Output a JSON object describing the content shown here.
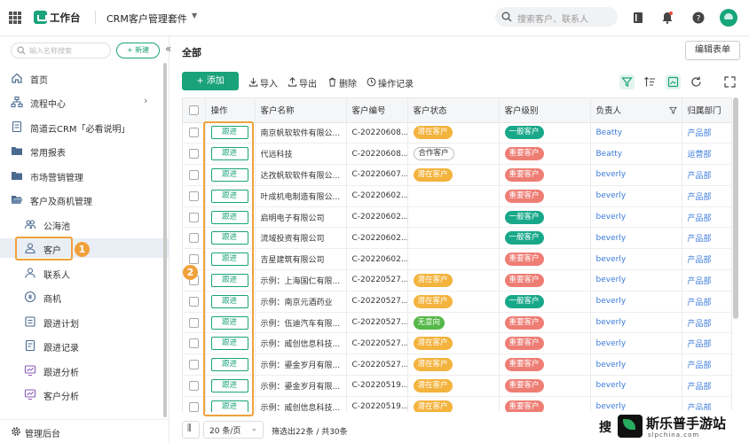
{
  "topbar": {
    "workbench": "工作台",
    "app_title": "CRM客户管理套件",
    "search_placeholder": "搜索客户、联系人"
  },
  "sidebar": {
    "search_placeholder": "输入名称搜索",
    "new_label": "+ 新建",
    "items": [
      {
        "label": "首页",
        "icon": "home-icon"
      },
      {
        "label": "流程中心",
        "icon": "flow-icon"
      },
      {
        "label": "简道云CRM「必看说明」",
        "icon": "doc-icon"
      },
      {
        "label": "常用报表",
        "icon": "folder-icon"
      },
      {
        "label": "市场营销管理",
        "icon": "folder-icon"
      },
      {
        "label": "客户及商机管理",
        "icon": "folder-open-icon"
      },
      {
        "label": "公海池",
        "icon": "pool-icon"
      },
      {
        "label": "客户",
        "icon": "user-icon"
      },
      {
        "label": "联系人",
        "icon": "contact-icon"
      },
      {
        "label": "商机",
        "icon": "opportunity-icon"
      },
      {
        "label": "跟进计划",
        "icon": "plan-icon"
      },
      {
        "label": "跟进记录",
        "icon": "record-icon"
      },
      {
        "label": "跟进分析",
        "icon": "analysis-icon"
      },
      {
        "label": "客户分析",
        "icon": "analysis-icon"
      }
    ],
    "footer": "管理后台",
    "marker1": "1"
  },
  "main": {
    "title": "全部",
    "edit_form": "编辑表单",
    "add": "添加",
    "tools": [
      "导入",
      "导出",
      "删除",
      "操作记录"
    ],
    "marker2": "2"
  },
  "table": {
    "headers": [
      "操作",
      "客户名称",
      "客户编号",
      "客户状态",
      "客户级别",
      "负责人",
      "归属部门"
    ],
    "follow_label": "跟进",
    "rows": [
      {
        "name": "南京帆软软件有限公...",
        "code": "C-20220608...",
        "status": "潜在客户",
        "level": "一般客户",
        "owner": "Beatty",
        "dept": "产品部"
      },
      {
        "name": "代远科技",
        "code": "C-20220608...",
        "status": "合作客户",
        "level": "重要客户",
        "owner": "Beatty",
        "dept": "运营部"
      },
      {
        "name": "达孜帆软软件有限公...",
        "code": "C-20220607...",
        "status": "潜在客户",
        "level": "重要客户",
        "owner": "beverly",
        "dept": "产品部"
      },
      {
        "name": "叶成机电制造有限公...",
        "code": "C-20220602...",
        "status": "",
        "level": "重要客户",
        "owner": "beverly",
        "dept": "产品部"
      },
      {
        "name": "启明电子有限公司",
        "code": "C-20220602...",
        "status": "",
        "level": "一般客户",
        "owner": "beverly",
        "dept": "产品部"
      },
      {
        "name": "流域投资有限公司",
        "code": "C-20220602...",
        "status": "",
        "level": "一般客户",
        "owner": "beverly",
        "dept": "产品部"
      },
      {
        "name": "吉星建筑有限公司",
        "code": "C-20220602...",
        "status": "",
        "level": "重要客户",
        "owner": "beverly",
        "dept": "产品部"
      },
      {
        "name": "示例：上海国仁有限...",
        "code": "C-20220527...",
        "status": "潜在客户",
        "level": "重要客户",
        "owner": "beverly",
        "dept": "产品部"
      },
      {
        "name": "示例：南京元酒药业",
        "code": "C-20220527...",
        "status": "潜在客户",
        "level": "一般客户",
        "owner": "beverly",
        "dept": "产品部"
      },
      {
        "name": "示例：伍迪汽车有限...",
        "code": "C-20220527...",
        "status": "无意向",
        "level": "重要客户",
        "owner": "beverly",
        "dept": "产品部"
      },
      {
        "name": "示例：威创信息科技...",
        "code": "C-20220527...",
        "status": "潜在客户",
        "level": "重要客户",
        "owner": "beverly",
        "dept": "产品部"
      },
      {
        "name": "示例：鎏金岁月有限...",
        "code": "C-20220527...",
        "status": "潜在客户",
        "level": "重要客户",
        "owner": "beverly",
        "dept": "产品部"
      },
      {
        "name": "示例：鎏金岁月有限...",
        "code": "C-20220519...",
        "status": "潜在客户",
        "level": "重要客户",
        "owner": "beverly",
        "dept": "产品部"
      },
      {
        "name": "示例：威创信息科技...",
        "code": "C-20220519...",
        "status": "潜在客户",
        "level": "重要客户",
        "owner": "beverly",
        "dept": "产品部"
      }
    ]
  },
  "footer": {
    "page_size": "20 条/页",
    "summary": "筛选出22条 / 共30条"
  },
  "watermark": {
    "search_char": "搜",
    "name": "斯乐普手游站",
    "url": "slpchina.com"
  },
  "colors": {
    "accent": "#1aa37a",
    "status_potential": "#f3b33d",
    "status_no_intent": "#56b848",
    "level_normal": "#18a889",
    "level_important": "#ee7d74",
    "highlight": "#f0a13a",
    "link": "#3a7ad9"
  }
}
